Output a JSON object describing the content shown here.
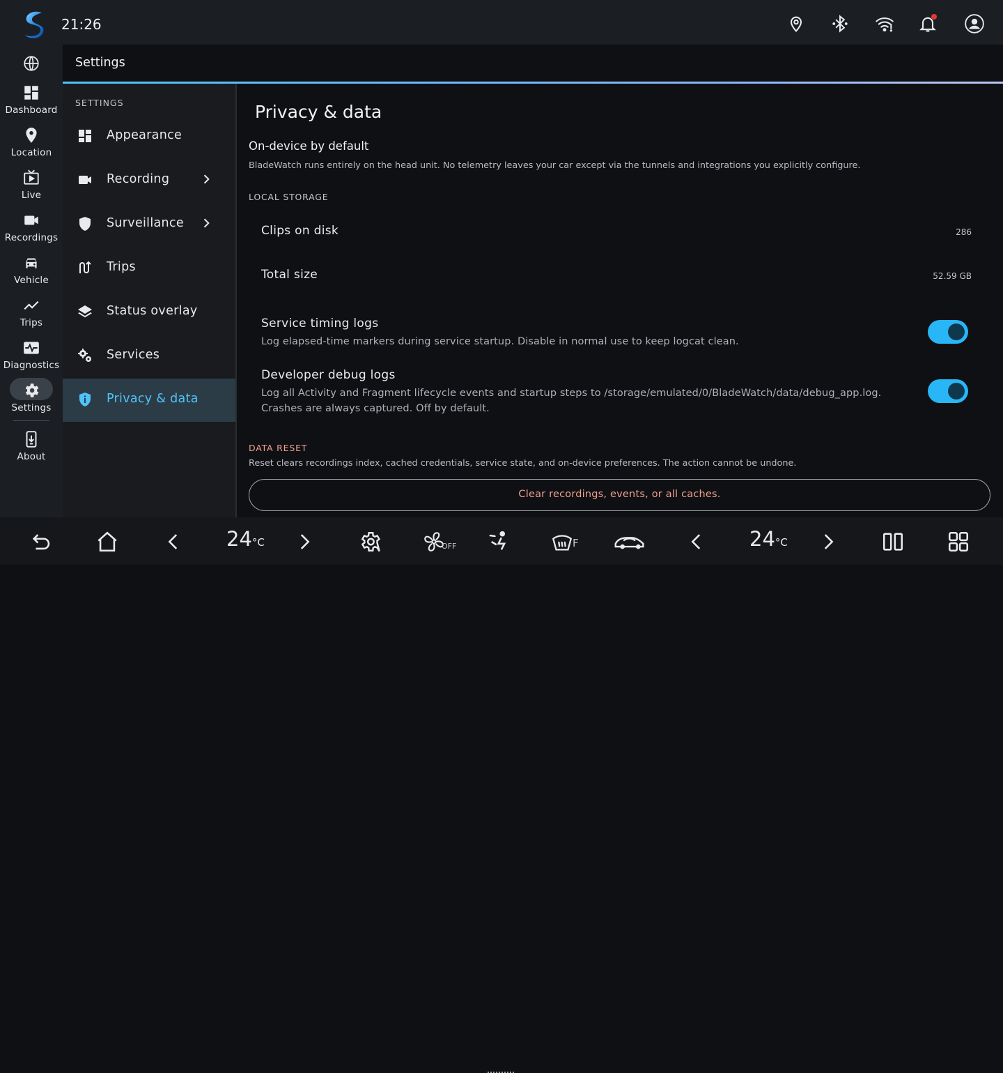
{
  "status_bar": {
    "time": "21:26",
    "icons": [
      "location-pin-icon",
      "bluetooth-icon",
      "wifi-icon",
      "bell-icon",
      "account-icon"
    ],
    "notification_dot_color": "#e53935"
  },
  "rail": {
    "items": [
      {
        "icon": "globe-icon",
        "label": ""
      },
      {
        "icon": "dashboard-icon",
        "label": "Dashboard"
      },
      {
        "icon": "location-icon",
        "label": "Location"
      },
      {
        "icon": "live-tv-icon",
        "label": "Live"
      },
      {
        "icon": "videocam-icon",
        "label": "Recordings"
      },
      {
        "icon": "car-icon",
        "label": "Vehicle"
      },
      {
        "icon": "trending-icon",
        "label": "Trips"
      },
      {
        "icon": "pulse-icon",
        "label": "Diagnostics"
      },
      {
        "icon": "gear-icon",
        "label": "Settings",
        "selected": true
      },
      {
        "icon": "download-device-icon",
        "label": "About"
      }
    ]
  },
  "header": {
    "title": "Settings"
  },
  "nav": {
    "heading": "SETTINGS",
    "items": [
      {
        "icon": "dashboard-icon",
        "label": "Appearance",
        "chevron": false
      },
      {
        "icon": "videocam-icon",
        "label": "Recording",
        "chevron": true
      },
      {
        "icon": "shield-icon",
        "label": "Surveillance",
        "chevron": true
      },
      {
        "icon": "route-icon",
        "label": "Trips",
        "chevron": false
      },
      {
        "icon": "layers-icon",
        "label": "Status overlay",
        "chevron": false
      },
      {
        "icon": "gears-icon",
        "label": "Services",
        "chevron": false
      },
      {
        "icon": "privacy-shield-icon",
        "label": "Privacy & data",
        "chevron": false,
        "active": true
      }
    ]
  },
  "content": {
    "title": "Privacy & data",
    "on_device": {
      "title": "On-device by default",
      "description": "BladeWatch runs entirely on the head unit. No telemetry leaves your car except via the tunnels and integrations you explicitly configure."
    },
    "local_storage": {
      "heading": "LOCAL STORAGE",
      "clips_label": "Clips on disk",
      "clips_value": "286",
      "size_label": "Total size",
      "size_value": "52.59 GB",
      "timing_logs": {
        "title": "Service timing logs",
        "description": "Log elapsed-time markers during service startup. Disable in normal use to keep logcat clean.",
        "enabled": true
      },
      "debug_logs": {
        "title": "Developer debug logs",
        "description_line1": "Log all Activity and Fragment lifecycle events and startup steps to /storage/emulated/0/BladeWatch/data/debug_app.log.",
        "description_line2": "Crashes are always captured. Off by default.",
        "enabled": true
      }
    },
    "data_reset": {
      "heading": "DATA RESET",
      "description": "Reset clears recordings index, cached credentials, service state, and on-device preferences. The action cannot be undone.",
      "button_label": "Clear recordings, events, or all caches."
    }
  },
  "bottom_bar": {
    "left_temp": "24",
    "right_temp": "24",
    "temp_unit": "°C",
    "fan_state": "OFF",
    "defrost_label": "F"
  },
  "colors": {
    "accent": "#4fc3f7",
    "toggle_on": "#29b6f6",
    "danger_text": "#f0a090"
  }
}
